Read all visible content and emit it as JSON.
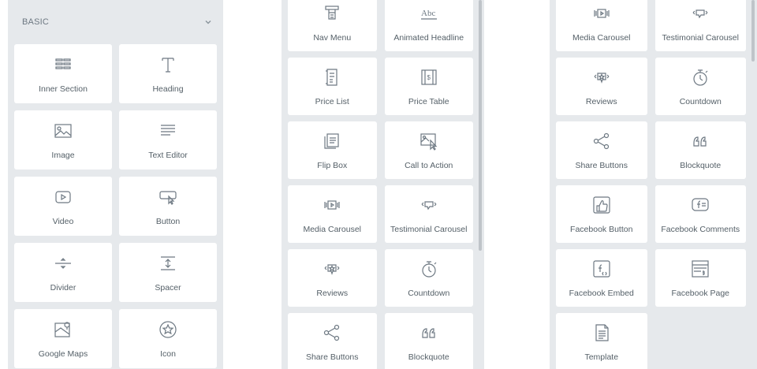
{
  "panel1": {
    "category": "BASIC",
    "widgets": [
      {
        "label": "Inner Section",
        "icon": "inner-section-icon"
      },
      {
        "label": "Heading",
        "icon": "heading-icon"
      },
      {
        "label": "Image",
        "icon": "image-icon"
      },
      {
        "label": "Text Editor",
        "icon": "text-editor-icon"
      },
      {
        "label": "Video",
        "icon": "video-icon"
      },
      {
        "label": "Button",
        "icon": "button-icon"
      },
      {
        "label": "Divider",
        "icon": "divider-icon"
      },
      {
        "label": "Spacer",
        "icon": "spacer-icon"
      },
      {
        "label": "Google Maps",
        "icon": "google-maps-icon"
      },
      {
        "label": "Icon",
        "icon": "star-icon"
      }
    ]
  },
  "panel2": {
    "widgets": [
      {
        "label": "Nav Menu",
        "icon": "nav-menu-icon"
      },
      {
        "label": "Animated Headline",
        "icon": "animated-headline-icon"
      },
      {
        "label": "Price List",
        "icon": "price-list-icon"
      },
      {
        "label": "Price Table",
        "icon": "price-table-icon"
      },
      {
        "label": "Flip Box",
        "icon": "flip-box-icon"
      },
      {
        "label": "Call to Action",
        "icon": "call-to-action-icon"
      },
      {
        "label": "Media Carousel",
        "icon": "media-carousel-icon"
      },
      {
        "label": "Testimonial Carousel",
        "icon": "testimonial-carousel-icon"
      },
      {
        "label": "Reviews",
        "icon": "reviews-icon"
      },
      {
        "label": "Countdown",
        "icon": "countdown-icon"
      },
      {
        "label": "Share Buttons",
        "icon": "share-icon"
      },
      {
        "label": "Blockquote",
        "icon": "blockquote-icon"
      }
    ]
  },
  "panel3": {
    "widgets": [
      {
        "label": "Media Carousel",
        "icon": "media-carousel-icon"
      },
      {
        "label": "Testimonial Carousel",
        "icon": "testimonial-carousel-icon"
      },
      {
        "label": "Reviews",
        "icon": "reviews-icon"
      },
      {
        "label": "Countdown",
        "icon": "countdown-icon"
      },
      {
        "label": "Share Buttons",
        "icon": "share-icon"
      },
      {
        "label": "Blockquote",
        "icon": "blockquote-icon"
      },
      {
        "label": "Facebook Button",
        "icon": "facebook-button-icon"
      },
      {
        "label": "Facebook Comments",
        "icon": "facebook-comments-icon"
      },
      {
        "label": "Facebook Embed",
        "icon": "facebook-embed-icon"
      },
      {
        "label": "Facebook Page",
        "icon": "facebook-page-icon"
      },
      {
        "label": "Template",
        "icon": "template-icon"
      }
    ]
  }
}
